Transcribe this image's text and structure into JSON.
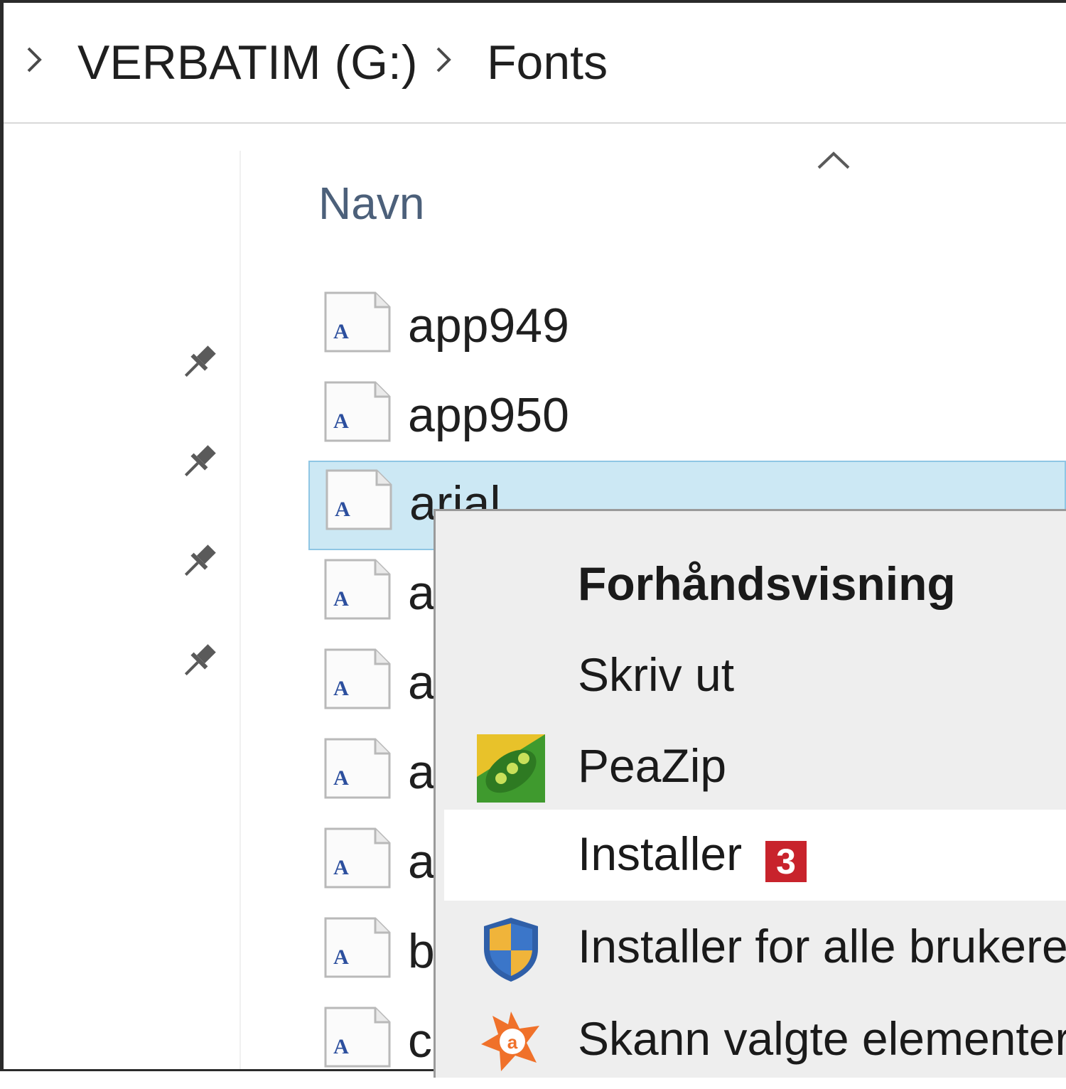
{
  "breadcrumb": {
    "segments": [
      "VERBATIM (G:)",
      "Fonts"
    ]
  },
  "file_list": {
    "column_header": "Navn",
    "sort_direction": "ascending",
    "files": [
      {
        "name": "app949",
        "selected": false
      },
      {
        "name": "app950",
        "selected": false
      },
      {
        "name": "arial",
        "selected": true
      },
      {
        "name": "a",
        "selected": false
      },
      {
        "name": "a",
        "selected": false
      },
      {
        "name": "a",
        "selected": false
      },
      {
        "name": "a",
        "selected": false
      },
      {
        "name": "b",
        "selected": false
      },
      {
        "name": "c",
        "selected": false
      }
    ]
  },
  "context_menu": {
    "items": [
      {
        "label": "Forhåndsvisning",
        "bold": true,
        "icon": null
      },
      {
        "label": "Skriv ut",
        "bold": false,
        "icon": null
      },
      {
        "label": "PeaZip",
        "bold": false,
        "icon": "peazip-icon"
      },
      {
        "label": "Installer",
        "bold": false,
        "icon": null,
        "badge": "3",
        "hovered": true
      },
      {
        "label": "Installer for alle brukere",
        "bold": false,
        "icon": "uac-shield-icon"
      },
      {
        "label": "Skann valgte elementer",
        "bold": false,
        "icon": "avast-icon"
      }
    ]
  },
  "colors": {
    "selection_bg": "#cce8f4",
    "selection_border": "#8fc6e4",
    "menu_bg": "#eeeeee",
    "badge": "#c8232c",
    "header_text": "#4c607a"
  }
}
